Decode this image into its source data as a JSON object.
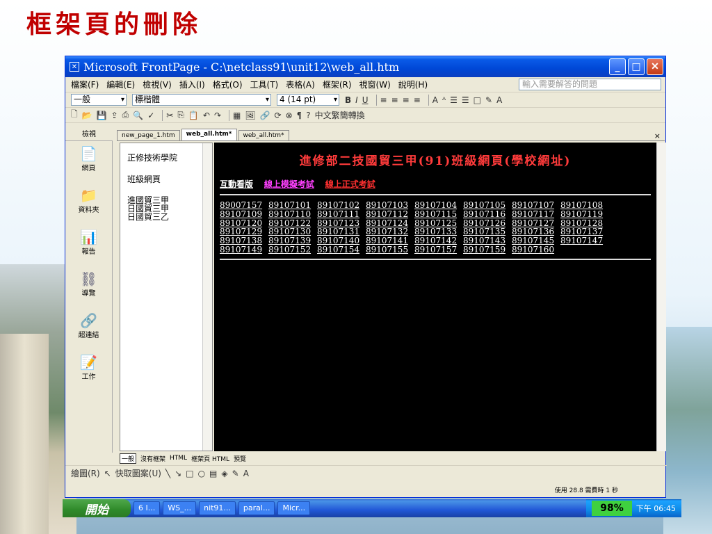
{
  "slide_title": "框架頁的刪除",
  "window": {
    "title": "Microsoft FrontPage - C:\\netclass91\\unit12\\web_all.htm",
    "menus": [
      "檔案(F)",
      "編輯(E)",
      "檢視(V)",
      "插入(I)",
      "格式(O)",
      "工具(T)",
      "表格(A)",
      "框架(R)",
      "視窗(W)",
      "說明(H)"
    ],
    "help_placeholder": "輸入需要解答的問題",
    "style_combo": "一般",
    "font_combo": "標楷體",
    "size_combo": "4 (14 pt)",
    "conversion_label": "中文繁簡轉換"
  },
  "views": {
    "header": "檢視",
    "items": [
      {
        "label": "網頁",
        "icon": "page-icon"
      },
      {
        "label": "資料夾",
        "icon": "folder-icon"
      },
      {
        "label": "報告",
        "icon": "report-icon"
      },
      {
        "label": "導覽",
        "icon": "navigation-icon"
      },
      {
        "label": "超連結",
        "icon": "hyperlink-icon"
      },
      {
        "label": "工作",
        "icon": "task-icon"
      }
    ]
  },
  "tabs": [
    "new_page_1.htm",
    "web_all.htm*",
    "web_all.htm*"
  ],
  "left_frame": {
    "school": "正修技術學院",
    "class_page": "班級網頁",
    "depts": [
      "進國貿三甲",
      "日國貿三甲",
      "日國貿三乙"
    ]
  },
  "main_frame": {
    "heading": "進修部二技國貿三甲(91)班級網頁(學校網址)",
    "links": [
      {
        "text": "互動看版",
        "color": "#ffffff"
      },
      {
        "text": "線上模擬考試",
        "color": "#ff40ff"
      },
      {
        "text": "線上正式考試",
        "color": "#ff3030"
      }
    ],
    "student_ids": [
      "89007157",
      "89107101",
      "89107102",
      "89107103",
      "89107104",
      "89107105",
      "89107107",
      "89107108",
      "89107109",
      "89107110",
      "89107111",
      "89107112",
      "89107115",
      "89107116",
      "89107117",
      "89107119",
      "89107120",
      "89107122",
      "89107123",
      "89107124",
      "89107125",
      "89107126",
      "89107127",
      "89107128",
      "89107129",
      "89107130",
      "89107131",
      "89107132",
      "89107133",
      "89107135",
      "89107136",
      "89107137",
      "89107138",
      "89107139",
      "89107140",
      "89107141",
      "89107142",
      "89107143",
      "89107145",
      "89107147",
      "89107149",
      "89107152",
      "89107154",
      "89107155",
      "89107157",
      "89107159",
      "89107160"
    ]
  },
  "mode_bar": [
    "一般",
    "沒有框架",
    "HTML",
    "框架頁 HTML",
    "預覽"
  ],
  "draw_bar": {
    "draw": "繪圖(R)",
    "autoshapes": "快取圖案(U)"
  },
  "status": "使用 28.8 需費時 1 秒",
  "taskbar": {
    "start": "開始",
    "tasks": [
      "6 I...",
      "WS_...",
      "nit91...",
      "paral...",
      "Micr..."
    ],
    "zoom": "98%",
    "clock": "下午 06:45"
  }
}
